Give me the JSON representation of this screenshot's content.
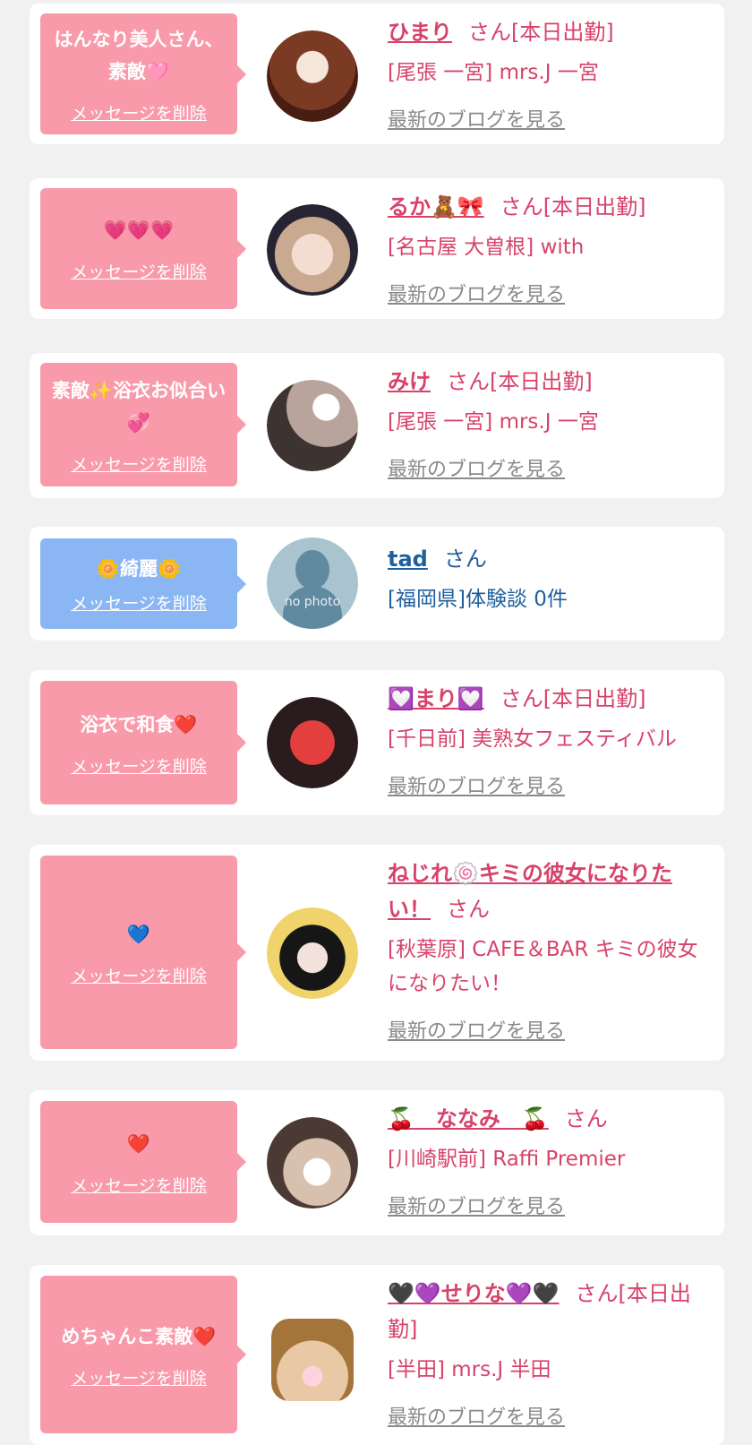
{
  "delete_label": "メッセージを削除",
  "blog_label": "最新のブログを見る",
  "colors": {
    "bubble_pink": "#f89aaa",
    "bubble_blue": "#8ab6f4",
    "text_pink": "#d7426b",
    "text_blue": "#1f5f9c",
    "link_gray": "#8a8a8a"
  },
  "items": [
    {
      "message": "はんなり美人さん、素敵🩷",
      "name": "ひまり",
      "suffix": "さん[本日出勤]",
      "shop": "[尾張 一宮] mrs.J 一宮",
      "avatar_icon": "profile-photo-icon"
    },
    {
      "message": "💗💗💗",
      "name": "るか🧸🎀",
      "suffix": "さん[本日出勤]",
      "shop": "[名古屋 大曽根] with",
      "avatar_icon": "profile-photo-icon"
    },
    {
      "message": "素敵✨浴衣お似合い💞",
      "name": "みけ",
      "suffix": "さん[本日出勤]",
      "shop": "[尾張 一宮] mrs.J 一宮",
      "avatar_icon": "profile-photo-icon"
    },
    {
      "message": "🌼綺麗🌼",
      "name": "tad",
      "suffix": "さん",
      "shop": "[福岡県]体験談 0件",
      "avatar_icon": "no-photo-icon",
      "avatar_text": "no photo"
    },
    {
      "message": "浴衣で和食❤️",
      "name": "💟まり💟",
      "suffix": "さん[本日出勤]",
      "shop": "[千日前] 美熟女フェスティバル",
      "avatar_icon": "profile-photo-icon"
    },
    {
      "message": "💙",
      "name": "ねじれ🍥キミの彼女になりたい！",
      "suffix": "さん",
      "shop": "[秋葉原] CAFE＆BAR キミの彼女になりたい！",
      "avatar_icon": "profile-photo-icon"
    },
    {
      "message": "❤️",
      "name": "🍒　ななみ　🍒",
      "suffix": "さん",
      "shop": "[川崎駅前] Raffi Premier",
      "avatar_icon": "profile-photo-icon"
    },
    {
      "message": "めちゃんこ素敵❤️",
      "name": "🖤💜せりな💜🖤",
      "suffix": "さん[本日出勤]",
      "shop": "[半田] mrs.J 半田",
      "avatar_icon": "profile-photo-icon"
    }
  ]
}
